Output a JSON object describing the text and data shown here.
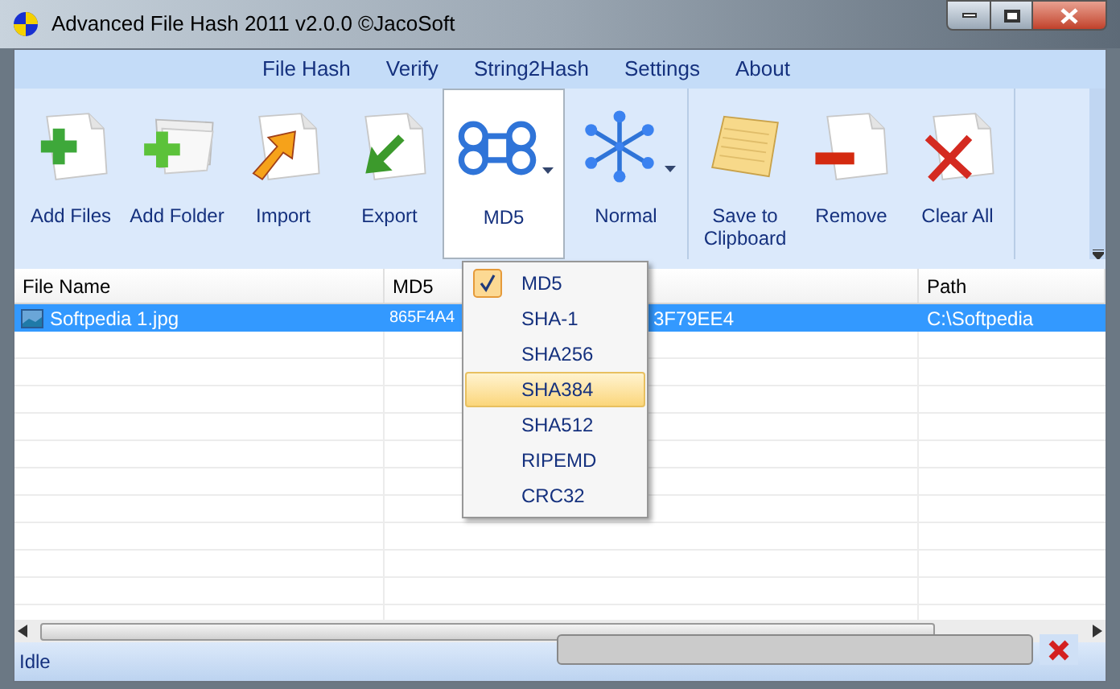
{
  "window": {
    "title": "Advanced File Hash 2011 v2.0.0 ©JacoSoft"
  },
  "menu": [
    "File Hash",
    "Verify",
    "String2Hash",
    "Settings",
    "About"
  ],
  "toolbar": [
    {
      "label": "Add Files",
      "kind": "button",
      "selected": false
    },
    {
      "label": "Add Folder",
      "kind": "button",
      "selected": false
    },
    {
      "label": "Import",
      "kind": "button",
      "selected": false
    },
    {
      "label": "Export",
      "kind": "button",
      "selected": false
    },
    {
      "label": "MD5",
      "kind": "dropdown",
      "selected": true
    },
    {
      "label": "Normal",
      "kind": "dropdown",
      "selected": false
    },
    {
      "label": "Save to Clipboard",
      "kind": "button",
      "selected": false
    },
    {
      "label": "Remove",
      "kind": "button",
      "selected": false
    },
    {
      "label": "Clear All",
      "kind": "button",
      "selected": false
    }
  ],
  "table": {
    "columns": [
      "File Name",
      "MD5",
      "Path"
    ],
    "rows": [
      {
        "file": "Softpedia 1.jpg",
        "hash_start": "865F4A4",
        "hash_end": "3F79EE4",
        "path": "C:\\Softpedia",
        "selected": true
      }
    ]
  },
  "hash_menu": [
    {
      "label": "MD5",
      "checked": true,
      "selected": false
    },
    {
      "label": "SHA-1",
      "checked": false,
      "selected": false
    },
    {
      "label": "SHA256",
      "checked": false,
      "selected": false
    },
    {
      "label": "SHA384",
      "checked": false,
      "selected": true
    },
    {
      "label": "SHA512",
      "checked": false,
      "selected": false
    },
    {
      "label": "RIPEMD",
      "checked": false,
      "selected": false
    },
    {
      "label": "CRC32",
      "checked": false,
      "selected": false
    }
  ],
  "status_bar": {
    "text": "Idle",
    "progress": {
      "level": 0
    }
  }
}
